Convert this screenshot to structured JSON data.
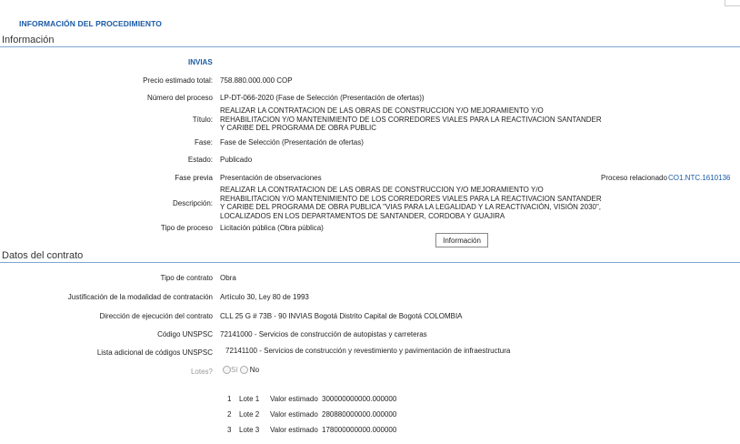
{
  "header": {
    "title": "INFORMACIÓN DEL PROCEDIMIENTO"
  },
  "informacion": {
    "section_title": "Información",
    "entity": "INVIAS",
    "precio_label": "Precio estimado total:",
    "precio_value": "758.880.000.000 COP",
    "numero_label": "Número del proceso",
    "numero_value": "LP-DT-066-2020 (Fase de Selección (Presentación de ofertas))",
    "titulo_label": "Título:",
    "titulo_value": "REALIZAR LA CONTRATACION DE LAS OBRAS DE CONSTRUCCION Y/O MEJORAMIENTO Y/O REHABILITACION Y/O MANTENIMIENTO DE LOS CORREDORES VIALES PARA LA REACTIVACION SANTANDER Y CARIBE DEL PROGRAMA DE OBRA PUBLIC",
    "fase_label": "Fase:",
    "fase_value": "Fase de Selección (Presentación de ofertas)",
    "estado_label": "Estado:",
    "estado_value": "Publicado",
    "fase_previa_label": "Fase previa",
    "fase_previa_value": "Presentación de observaciones",
    "proceso_rel_label": "Proceso relacionado",
    "proceso_rel_value": "CO1.NTC.1610136",
    "descripcion_label": "Descripción:",
    "descripcion_value": "REALIZAR LA CONTRATACION DE LAS OBRAS DE CONSTRUCCION Y/O MEJORAMIENTO Y/O REHABILITACION Y/O MANTENIMIENTO DE LOS CORREDORES VIALES PARA LA REACTIVACION SANTANDER Y CARIBE DEL PROGRAMA DE OBRA PUBLICA \"VIAS PARA LA LEGALIDAD Y LA REACTIVACIÓN, VISIÓN 2030\", LOCALIZADOS EN LOS DEPARTAMENTOS DE SANTANDER, CORDOBA Y GUAJIRA",
    "tipo_proceso_label": "Tipo de proceso",
    "tipo_proceso_value": "Licitación pública (Obra pública)",
    "info_button": "Información"
  },
  "contrato": {
    "section_title": "Datos del contrato",
    "tipo_label": "Tipo de contrato",
    "tipo_value": "Obra",
    "justificacion_label": "Justificación de la modalidad de contratación",
    "justificacion_value": "Artículo 30, Ley 80 de 1993",
    "direccion_label": "Dirección de ejecución del contrato",
    "direccion_value": "CLL 25 G # 73B - 90 INVIAS Bogotá Distrito Capital de Bogotá COLOMBIA",
    "unspsc_label": "Código UNSPSC",
    "unspsc_value": "72141000 - Servicios de construcción de autopistas y carreteras",
    "lista_label": "Lista adicional de códigos UNSPSC",
    "lista_value": "72141100 - Servicios de construcción y revestimiento y pavimentación de infraestructura",
    "lotes_label": "Lotes?",
    "lotes_si": "Sí",
    "lotes_no": "No",
    "lotes": [
      {
        "num": "1",
        "name": "Lote 1",
        "valor_label": "Valor estimado",
        "valor": "300000000000.000000"
      },
      {
        "num": "2",
        "name": "Lote 2",
        "valor_label": "Valor estimado",
        "valor": "280880000000.000000"
      },
      {
        "num": "3",
        "name": "Lote 3",
        "valor_label": "Valor estimado",
        "valor": "178000000000.000000"
      }
    ]
  }
}
